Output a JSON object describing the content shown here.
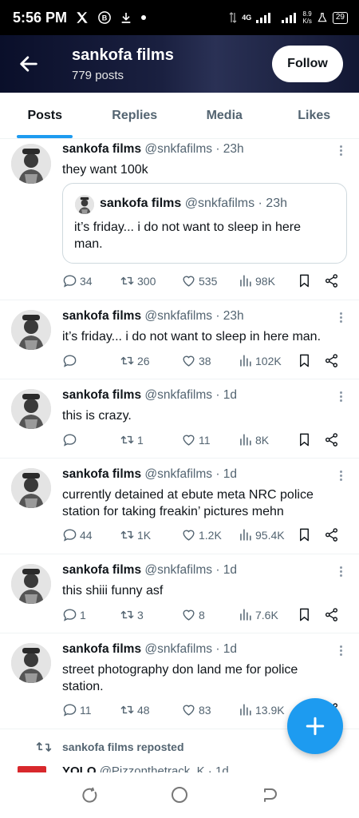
{
  "status_bar": {
    "time": "5:56 PM",
    "icons": [
      "x-logo-icon",
      "b-circle-icon",
      "download-icon",
      "dot-icon"
    ],
    "network": "4G",
    "net_speed_value": "8.9",
    "net_speed_unit": "K/s",
    "battery": "29"
  },
  "header": {
    "title": "sankofa films",
    "subtitle": "779 posts",
    "follow_label": "Follow",
    "back_icon": "arrow-left-icon"
  },
  "tabs": [
    {
      "label": "Posts",
      "active": true
    },
    {
      "label": "Replies",
      "active": false
    },
    {
      "label": "Media",
      "active": false
    },
    {
      "label": "Likes",
      "active": false
    }
  ],
  "posts": [
    {
      "name": "sankofa films",
      "handle": "@snkfafilms · 23h",
      "text": "they want 100k",
      "quote": {
        "name": "sankofa films",
        "handle": "@snkfafilms · 23h",
        "text": "it’s friday... i do not want to sleep in here man."
      },
      "replies": "34",
      "reposts": "300",
      "likes": "535",
      "views": "98K"
    },
    {
      "name": "sankofa films",
      "handle": "@snkfafilms · 23h",
      "text": "it’s friday... i do not want to sleep in here man.",
      "replies": "",
      "reposts": "26",
      "likes": "38",
      "views": "102K"
    },
    {
      "name": "sankofa films",
      "handle": "@snkfafilms · 1d",
      "text": "this is crazy.",
      "replies": "",
      "reposts": "1",
      "likes": "11",
      "views": "8K"
    },
    {
      "name": "sankofa films",
      "handle": "@snkfafilms · 1d",
      "text": "currently detained at ebute meta NRC police station for taking freakin’ pictures mehn",
      "replies": "44",
      "reposts": "1K",
      "likes": "1.2K",
      "views": "95.4K"
    },
    {
      "name": "sankofa films",
      "handle": "@snkfafilms · 1d",
      "text": "this shiii funny asf",
      "replies": "1",
      "reposts": "3",
      "likes": "8",
      "views": "7.6K"
    },
    {
      "name": "sankofa films",
      "handle": "@snkfafilms · 1d",
      "text": "street photography don land me for police station.",
      "replies": "11",
      "reposts": "48",
      "likes": "83",
      "views": "13.9K"
    }
  ],
  "repost_notice": "sankofa films reposted",
  "next_post_partial": {
    "name": "YOLO",
    "handle": "@Pizzonthetrack_K · 1d"
  },
  "fab_icon": "plus-icon",
  "colors": {
    "accent": "#1d9bf0",
    "text": "#0f1419",
    "muted": "#536471",
    "border": "#eff3f4"
  }
}
